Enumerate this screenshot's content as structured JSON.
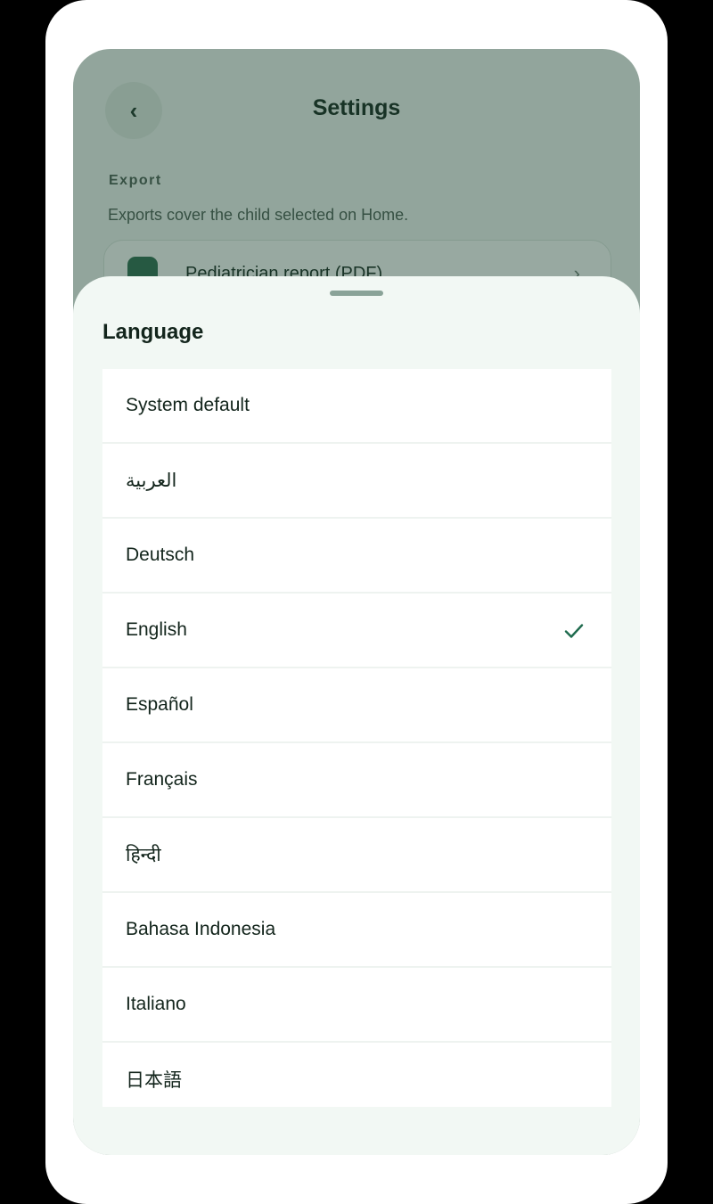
{
  "settings": {
    "back_icon": "chevron-left-icon",
    "back_glyph": "‹",
    "title": "Settings",
    "export_section": {
      "label": "Export",
      "description": "Exports cover the child selected on Home.",
      "item_label": "Pediatrician report (PDF)",
      "item_icon": "pdf-file-icon",
      "chevron_glyph": "›"
    }
  },
  "language_sheet": {
    "title": "Language",
    "selected": "English",
    "options": [
      {
        "label": "System default",
        "selected": false
      },
      {
        "label": "العربية",
        "selected": false
      },
      {
        "label": "Deutsch",
        "selected": false
      },
      {
        "label": "English",
        "selected": true
      },
      {
        "label": "Español",
        "selected": false
      },
      {
        "label": "Français",
        "selected": false
      },
      {
        "label": "हिन्दी",
        "selected": false
      },
      {
        "label": "Bahasa Indonesia",
        "selected": false
      },
      {
        "label": "Italiano",
        "selected": false
      },
      {
        "label": "日本語",
        "selected": false
      }
    ],
    "check_icon": "checkmark-icon"
  },
  "colors": {
    "accent": "#1f6b4e",
    "scrim": "#1e4432",
    "sheet_background": "#f2f8f4"
  }
}
